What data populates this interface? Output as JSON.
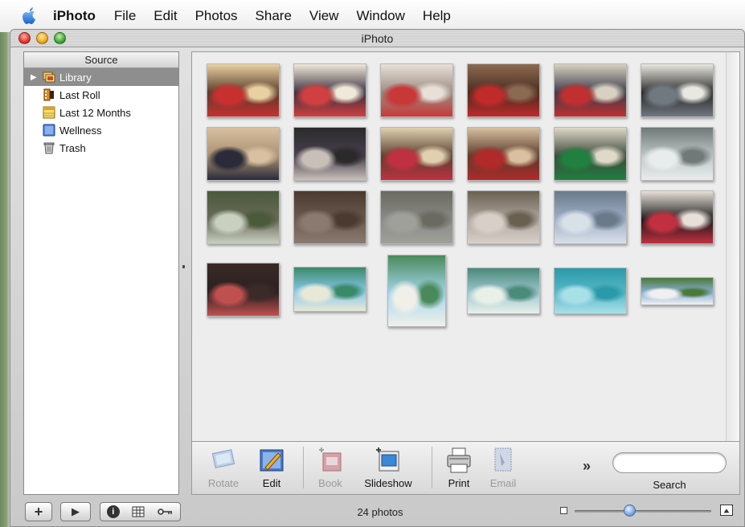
{
  "menubar": {
    "app_name": "iPhoto",
    "items": [
      "File",
      "Edit",
      "Photos",
      "Share",
      "View",
      "Window",
      "Help"
    ]
  },
  "window": {
    "title": "iPhoto"
  },
  "source": {
    "header": "Source",
    "items": [
      {
        "label": "Library",
        "icon": "library-icon",
        "selected": true
      },
      {
        "label": "Last Roll",
        "icon": "film-roll-icon"
      },
      {
        "label": "Last 12 Months",
        "icon": "calendar-icon"
      },
      {
        "label": "Wellness",
        "icon": "album-icon"
      },
      {
        "label": "Trash",
        "icon": "trash-icon"
      }
    ]
  },
  "photos": {
    "thumbnails": [
      {
        "name": "halloween-party-1",
        "colors": [
          "#5a3a2a",
          "#c83030",
          "#e8d0a0"
        ]
      },
      {
        "name": "halloween-party-2",
        "colors": [
          "#3a3040",
          "#d04040",
          "#f0e8d8"
        ]
      },
      {
        "name": "halloween-party-3",
        "colors": [
          "#9a8a80",
          "#c83838",
          "#e8e0d8"
        ]
      },
      {
        "name": "halloween-party-4",
        "colors": [
          "#4a2a20",
          "#c02a2a",
          "#8a6a50"
        ]
      },
      {
        "name": "halloween-party-5",
        "colors": [
          "#3a3a4a",
          "#c03030",
          "#d8d0c0"
        ]
      },
      {
        "name": "halloween-party-6",
        "colors": [
          "#2a2a2a",
          "#707880",
          "#e8e8e0"
        ]
      },
      {
        "name": "halloween-party-7",
        "colors": [
          "#a89070",
          "#2a2a3a",
          "#d8c0a0"
        ]
      },
      {
        "name": "halloween-party-8",
        "colors": [
          "#4a4050",
          "#c8c0b8",
          "#2a2a2a"
        ]
      },
      {
        "name": "halloween-party-9",
        "colors": [
          "#5a4030",
          "#c03040",
          "#e0d0b0"
        ]
      },
      {
        "name": "halloween-party-10",
        "colors": [
          "#5a3a2a",
          "#b02a2a",
          "#d8c0a0"
        ]
      },
      {
        "name": "halloween-party-11",
        "colors": [
          "#3a4a3a",
          "#208040",
          "#e0d8c8"
        ]
      },
      {
        "name": "mall-interior",
        "colors": [
          "#c0c8c8",
          "#e8ecec",
          "#707878"
        ]
      },
      {
        "name": "living-room",
        "colors": [
          "#6a6a5a",
          "#c8d0c0",
          "#4a5a3a"
        ]
      },
      {
        "name": "old-book-pages",
        "colors": [
          "#6a5a50",
          "#8a7a70",
          "#4a3a30"
        ]
      },
      {
        "name": "hazy-city-view",
        "colors": [
          "#8a8a88",
          "#a0a09a",
          "#6a6a60"
        ]
      },
      {
        "name": "gallery-room",
        "colors": [
          "#b0a8a0",
          "#d8d0c8",
          "#6a6050"
        ]
      },
      {
        "name": "harbor-boats",
        "colors": [
          "#a0b0c8",
          "#d8e0e8",
          "#6a7a8a"
        ]
      },
      {
        "name": "night-party",
        "colors": [
          "#1a1a1a",
          "#c03040",
          "#e8e0d8"
        ]
      },
      {
        "name": "night-party-2",
        "colors": [
          "#2a2020",
          "#c05050",
          "#3a2a28"
        ]
      },
      {
        "name": "beach-palm",
        "colors": [
          "#88c8e8",
          "#e8e8d8",
          "#3a8a6a"
        ]
      },
      {
        "name": "beach-portrait",
        "colors": [
          "#a8d8f0",
          "#f0f0e8",
          "#4a8a5a"
        ]
      },
      {
        "name": "beach-shore",
        "colors": [
          "#a0c8d0",
          "#e8f0e8",
          "#4a8a7a"
        ]
      },
      {
        "name": "turquoise-sea",
        "colors": [
          "#5ab8c8",
          "#a8e0e8",
          "#2a9aa8"
        ]
      },
      {
        "name": "resort-panorama",
        "colors": [
          "#8ab0d8",
          "#f0f0f0",
          "#4a7a3a"
        ]
      }
    ]
  },
  "toolbar": {
    "rotate": "Rotate",
    "edit": "Edit",
    "book": "Book",
    "slideshow": "Slideshow",
    "print": "Print",
    "email": "Email",
    "more": "»",
    "search_value": "",
    "search_label": "Search"
  },
  "bottombar": {
    "photo_count": "24 photos",
    "add_symbol": "+",
    "play_symbol": "▶",
    "info_symbol": "i",
    "zoom_level": 0.4
  }
}
